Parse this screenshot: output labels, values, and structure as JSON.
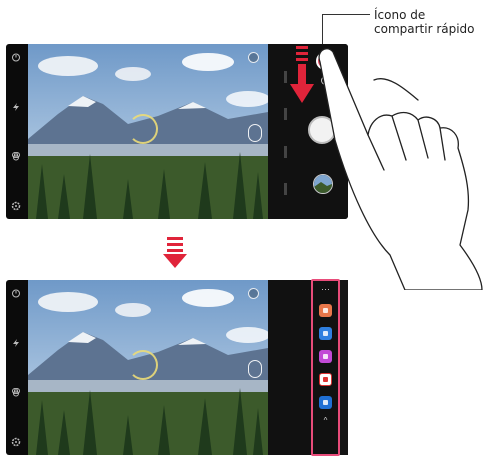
{
  "callout": {
    "line1": "Ícono de",
    "line2": "compartir rápido"
  },
  "icons": {
    "left_bar": [
      "timer-icon",
      "flash-icon",
      "filter-icon",
      "settings-icon"
    ],
    "viewfinder": [
      "switch-camera-icon",
      "voice-shutter-icon",
      "focus-ring-icon"
    ],
    "transition": "down-arrow-icon",
    "gesture": "drag-down-arrow-icon"
  },
  "share_tray": {
    "more_label": "···",
    "collapse_label": "^",
    "apps": [
      {
        "name": "gallery-app-icon",
        "color": "#e8774a"
      },
      {
        "name": "messenger-app-icon",
        "color": "#2f7fe0"
      },
      {
        "name": "pen-app-icon",
        "color": "#c24ad6"
      },
      {
        "name": "email-app-icon",
        "color": "#ffffff"
      },
      {
        "name": "chat-app-icon",
        "color": "#1f6fd4"
      }
    ]
  },
  "colors": {
    "accent": "#e84c63",
    "tray_border": "#e84c7a",
    "arrow": "#e0243a"
  }
}
